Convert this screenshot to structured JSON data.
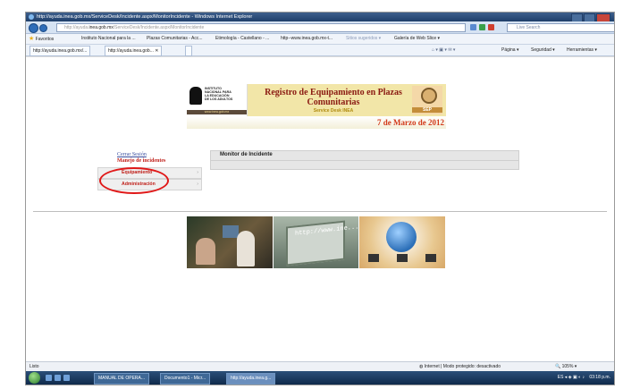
{
  "window": {
    "title": "http://ayuda.inea.gob.mx/ServiceDesk/Incidente.aspx/MonitorIncidente - Windows Internet Explorer"
  },
  "address_bar": {
    "url_prefix": "http://ayuda.",
    "url_domain": "inea.gob.mx",
    "url_path": "/ServiceDesk/Incidente.aspx/MonitorIncidente",
    "search_placeholder": "Live Search"
  },
  "favorites_bar": {
    "favorites_label": "Favoritos",
    "items": [
      "Instituto Nacional para la ...",
      "Plazas Comunitarias - Acc...",
      "Etimología - Castellano - ...",
      "http--www.inea.gob.mx-t...",
      "Sitios sugeridos ▾",
      "Galería de Web Slice ▾"
    ]
  },
  "tabs": [
    {
      "label": "http://ayuda.inea.gob.mx/..."
    },
    {
      "label": "http://ayuda.inea.gob...  ✕"
    }
  ],
  "command_bar": {
    "page_label": "Página ▾",
    "security_label": "Seguridad ▾",
    "tools_label": "Herramientas ▾"
  },
  "banner": {
    "logo_lines": "INSTITUTO\nNACIONAL PARA\nLA EDUCACIÓN\nDE LOS ADULTOS",
    "logo_url": "www.inea.gob.mx",
    "title": "Registro de Equipamiento en Plazas Comunitarias",
    "subtitle": "Service Desk INEA",
    "sep_label": "SEP",
    "date": "7 de Marzo de 2012"
  },
  "sidebar": {
    "logout": "Cerrar Sesión",
    "section_title": "Manejo de incidentes",
    "items": [
      {
        "label": "Equipamiento"
      },
      {
        "label": "Administración"
      }
    ]
  },
  "main": {
    "monitor_title": "Monitor de Incidente"
  },
  "photos": {
    "screen_url_text": "http://www.ine..."
  },
  "status_bar": {
    "done": "Listo",
    "zone": "Internet | Modo protegido: desactivado",
    "zoom": "105%"
  },
  "taskbar": {
    "tasks": [
      {
        "label": "MANUAL DE OPERA..."
      },
      {
        "label": "Documento1 - Micr..."
      },
      {
        "label": "http://ayuda.inea.g..."
      }
    ],
    "clock": "03:18 p.m."
  },
  "colors": {
    "accent_red": "#c0201a",
    "banner_title": "#8a1a12",
    "date": "#d23a1a",
    "highlight_oval": "#e01818",
    "ie_titlebar": "#2b4b78"
  }
}
